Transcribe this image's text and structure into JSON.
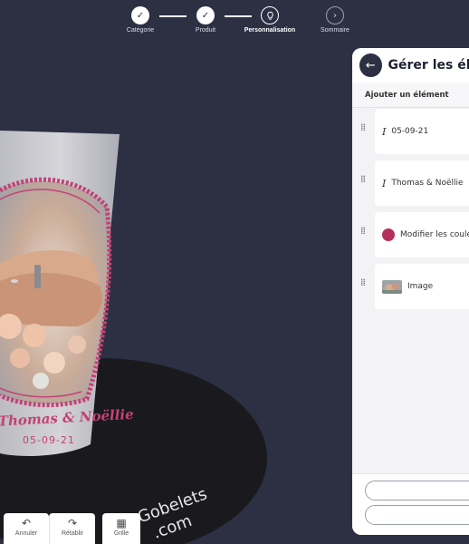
{
  "stepper": {
    "steps": [
      {
        "label": "Catégorie",
        "state": "done",
        "icon": "check-icon"
      },
      {
        "label": "Produit",
        "state": "done",
        "icon": "check-icon"
      },
      {
        "label": "Personnalisation",
        "state": "active",
        "icon": "lightbulb-icon"
      },
      {
        "label": "Sommaire",
        "state": "todo",
        "icon": "chevron-right-icon"
      }
    ]
  },
  "product": {
    "names": "Thomas & Noëllie",
    "date": "05-09-21",
    "plate_brand_line1": "Gobelets",
    "plate_brand_line2": ".com"
  },
  "toolbar": {
    "undo_label": "Annuler",
    "redo_label": "Rétablir",
    "grid_label": "Grille"
  },
  "panel": {
    "title": "Gérer les élé",
    "add_element_label": "Ajouter un élément",
    "items": [
      {
        "label": "05-09-21",
        "icon": "text-icon"
      },
      {
        "label": "Thomas & Noëllie",
        "icon": "text-icon"
      },
      {
        "label": "Modifier les coule",
        "icon": "color-dot-icon"
      },
      {
        "label": "Image",
        "icon": "image-thumbnail"
      }
    ]
  },
  "colors": {
    "background": "#2c3042",
    "accent": "#b4305c",
    "panel": "#f3f3f6"
  }
}
